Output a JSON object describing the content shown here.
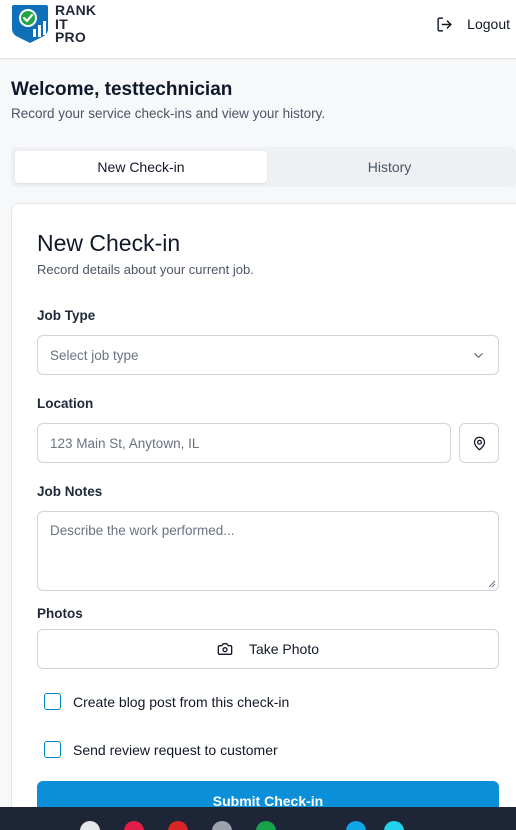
{
  "header": {
    "logo_lines": [
      "RANK",
      "IT",
      "PRO"
    ],
    "logout_label": "Logout"
  },
  "welcome": {
    "title": "Welcome, testtechnician",
    "subtitle": "Record your service check-ins and view your history."
  },
  "tabs": [
    {
      "label": "New Check-in",
      "active": true
    },
    {
      "label": "History",
      "active": false
    }
  ],
  "form": {
    "title": "New Check-in",
    "subtitle": "Record details about your current job.",
    "job_type": {
      "label": "Job Type",
      "placeholder": "Select job type"
    },
    "location": {
      "label": "Location",
      "placeholder": "123 Main St, Anytown, IL"
    },
    "notes": {
      "label": "Job Notes",
      "placeholder": "Describe the work performed..."
    },
    "photos": {
      "label": "Photos",
      "button_label": "Take Photo"
    },
    "options": [
      {
        "label": "Create blog post from this check-in",
        "checked": false
      },
      {
        "label": "Send review request to customer",
        "checked": false
      }
    ],
    "submit_label": "Submit Check-in"
  },
  "colors": {
    "primary": "#0a8fd8",
    "checkbox_border": "#0284c7",
    "logo_blue": "#0f6fb8",
    "logo_green": "#22a447"
  },
  "icons": [
    "logo-icon",
    "logout-icon",
    "chevron-down-icon",
    "map-pin-icon",
    "camera-icon",
    "resize-grip-icon"
  ]
}
